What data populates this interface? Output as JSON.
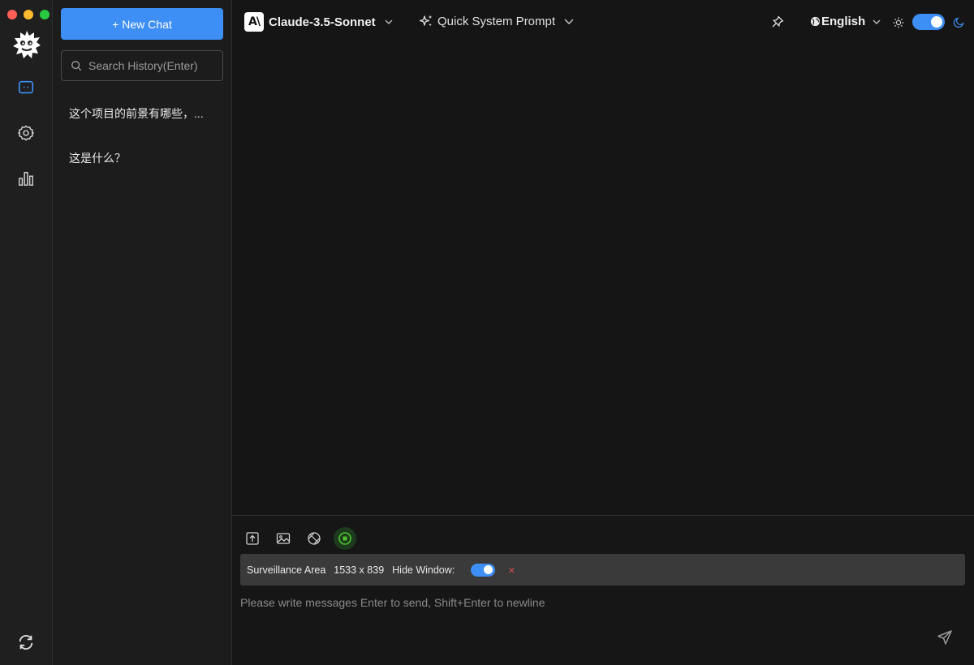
{
  "window": {
    "controls": [
      "close",
      "minimize",
      "maximize"
    ]
  },
  "rail": {
    "logo_icon": "spiky-mascot-logo",
    "items": [
      {
        "icon": "chat-bubble-icon",
        "active": true
      },
      {
        "icon": "gear-icon",
        "active": false
      },
      {
        "icon": "bar-chart-icon",
        "active": false
      }
    ],
    "bottom_icon": "sync-icon"
  },
  "history": {
    "new_chat_label": "+ New Chat",
    "search_placeholder": "Search History(Enter)",
    "items": [
      {
        "title": "这个项目的前景有哪些，..."
      },
      {
        "title": "这是什么？"
      }
    ]
  },
  "header": {
    "model_logo_text": "A\\",
    "model_name": "Claude-3.5-Sonnet",
    "quick_prompt_label": "Quick System Prompt",
    "language_label": "English",
    "theme_dark": true
  },
  "composer": {
    "tools": [
      "upload-file-icon",
      "image-icon",
      "screenshot-icon",
      "record-icon"
    ],
    "surveillance": {
      "label": "Surveillance Area",
      "size": "1533 x 839",
      "hide_window_label": "Hide Window:",
      "hide_window_on": true,
      "close_symbol": "×"
    },
    "input_placeholder": "Please write messages Enter to send, Shift+Enter to newline"
  },
  "colors": {
    "accent": "#3d8ff5",
    "record": "#4cc42a",
    "close": "#e05050"
  }
}
